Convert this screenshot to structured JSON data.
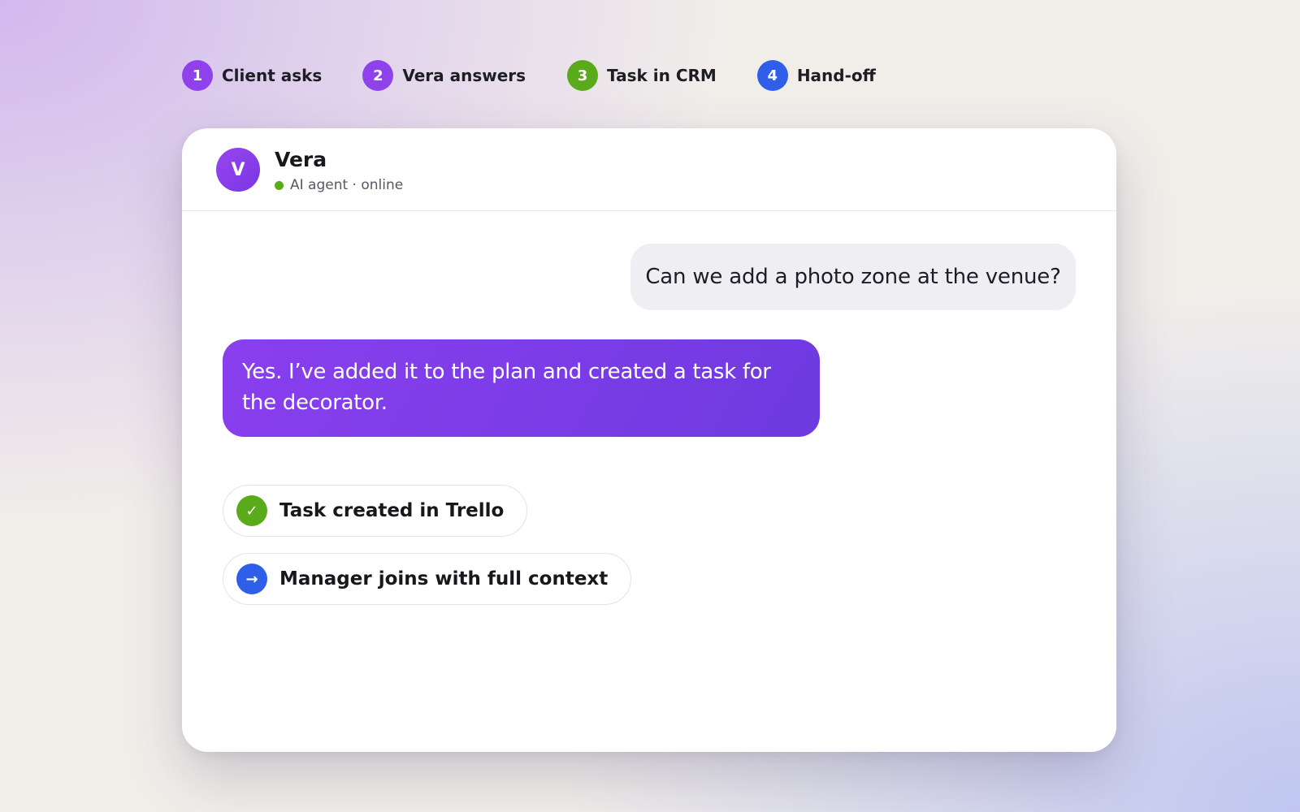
{
  "steps": [
    {
      "number": "1",
      "label": "Client asks",
      "color": "#8f42ec"
    },
    {
      "number": "2",
      "label": "Vera answers",
      "color": "#8f42ec"
    },
    {
      "number": "3",
      "label": "Task in CRM",
      "color": "#5aab1c"
    },
    {
      "number": "4",
      "label": "Hand-off",
      "color": "#2f5fe8"
    }
  ],
  "agent": {
    "avatar_letter": "V",
    "name": "Vera",
    "status": "AI agent · online",
    "status_color": "#5aab1c"
  },
  "messages": {
    "user": "Can we add a photo zone at the venue?",
    "agent": "Yes. I’ve added it to the plan and created a task for the decorator."
  },
  "actions": [
    {
      "icon": "✓",
      "icon_name": "check-icon",
      "label": "Task created in Trello",
      "color": "#5aab1c"
    },
    {
      "icon": "→",
      "icon_name": "arrow-right-icon",
      "label": "Manager joins with full context",
      "color": "#2f5fe8"
    }
  ],
  "colors": {
    "accent": "#8a3fee",
    "user_bubble": "#efeff3"
  }
}
